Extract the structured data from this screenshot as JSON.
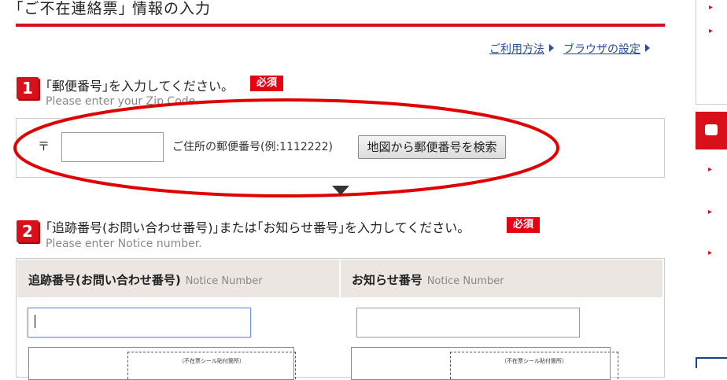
{
  "header": {
    "title": "｢ご不在連絡票｣ 情報の入力",
    "links": [
      {
        "label": "ご利用方法"
      },
      {
        "label": "ブラウザの設定"
      }
    ]
  },
  "step1": {
    "number": "1",
    "label": "｢郵便番号｣を入力してください。",
    "required": "必須",
    "sublabel": "Please enter your Zip Code.",
    "postal_mark": "〒",
    "zip_value": "",
    "help": "ご住所の郵便番号(例:1112222)",
    "map_button": "地図から郵便番号を検索"
  },
  "step2": {
    "number": "2",
    "label": "｢追跡番号(お問い合わせ番号)｣または｢お知らせ番号｣を入力してください。",
    "required": "必須",
    "sublabel": "Please enter Notice  number.",
    "columns": [
      {
        "label": "追跡番号(お問い合わせ番号)",
        "en": "Notice Number",
        "value": "",
        "sticker_caption": "（不在票シール貼付箇所）"
      },
      {
        "label": "お知らせ番号",
        "en": "Notice Number",
        "value": "",
        "sticker_caption": "（不在票シール貼付箇所）"
      }
    ]
  },
  "colors": {
    "accent": "#d7101a",
    "link": "#2a4c9a",
    "annotation": "#e00000"
  }
}
